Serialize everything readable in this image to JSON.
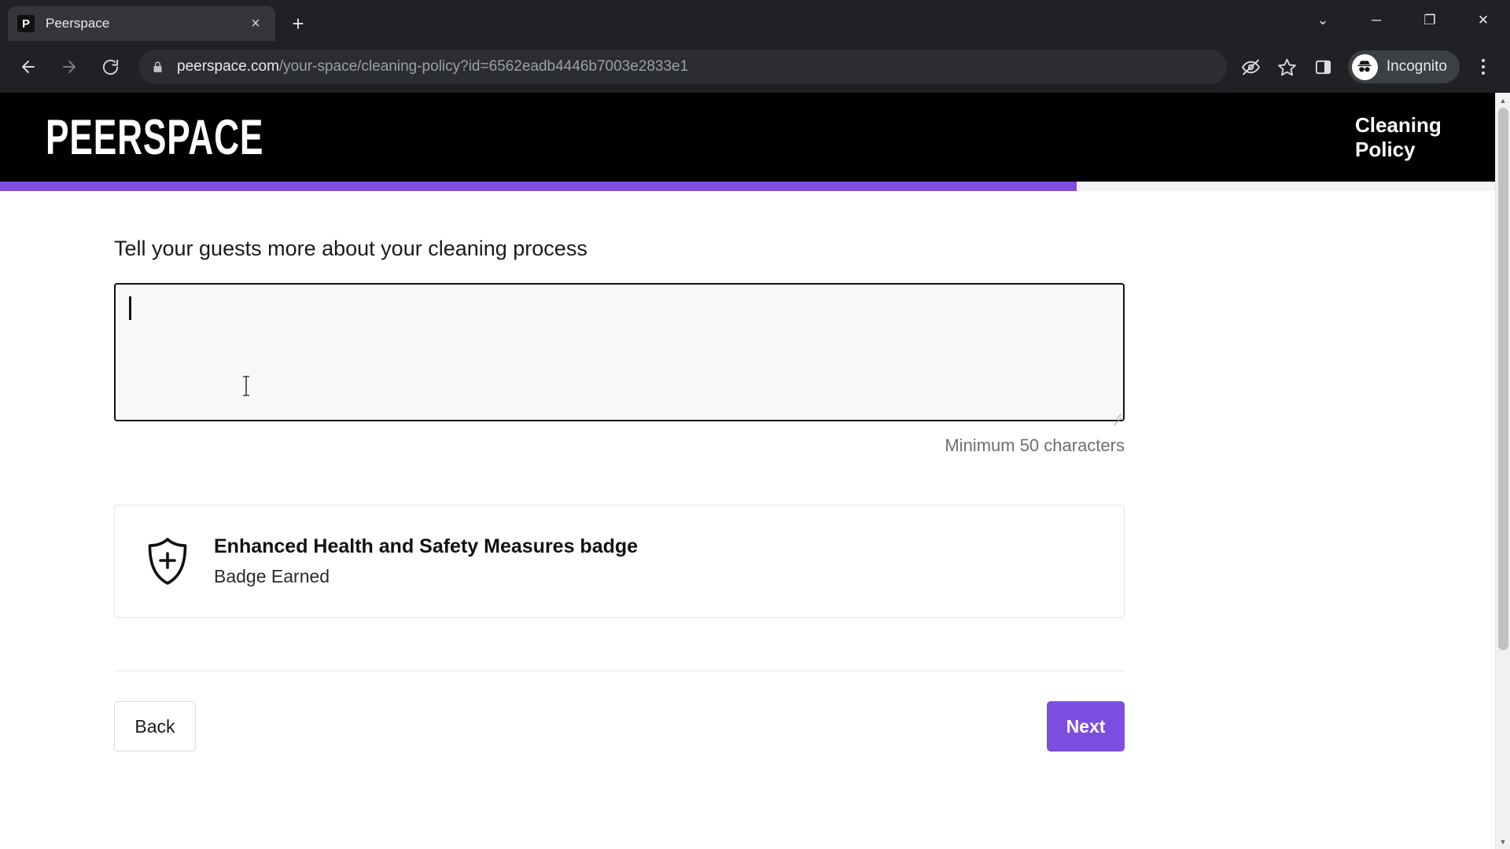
{
  "browser": {
    "tab": {
      "title": "Peerspace",
      "favicon_letter": "P",
      "favicon_name": "peerspace-favicon",
      "close_label": "×"
    },
    "new_tab_label": "+",
    "window_controls": {
      "minimize_all": "⌄",
      "minimize": "─",
      "maximize": "❐",
      "close": "✕"
    },
    "nav": {
      "back": "←",
      "forward": "→",
      "reload": "⟳"
    },
    "omnibox": {
      "lock_icon": "lock-icon",
      "url_host": "peerspace.com",
      "url_path": "/your-space/cleaning-policy?id=6562eadb4446b7003e2833e1",
      "full_url": "peerspace.com/your-space/cleaning-policy?id=6562eadb4446b7003e2833e1"
    },
    "toolbar_icons": [
      "third-party-cookie-blocked-icon",
      "bookmark-star-icon",
      "side-panel-icon"
    ],
    "profile": {
      "label": "Incognito",
      "avatar_icon": "incognito-avatar-icon"
    },
    "menu_icon": "kebab-menu-icon"
  },
  "page": {
    "header": {
      "logo_text": "PEERSPACE",
      "step_title_line1": "Cleaning",
      "step_title_line2": "Policy"
    },
    "progress": {
      "percent": 72,
      "fill_color": "#7c4ee0",
      "track_color": "#f4f4f6"
    },
    "main": {
      "section_title": "Tell your guests more about your cleaning process",
      "textarea": {
        "value": "",
        "placeholder": ""
      },
      "helper_text": "Minimum 50 characters",
      "badge": {
        "icon": "shield-plus-icon",
        "title": "Enhanced Health and Safety Measures badge",
        "status": "Badge Earned"
      },
      "actions": {
        "back_label": "Back",
        "next_label": "Next"
      }
    }
  },
  "colors": {
    "brand_purple": "#7c4ee0",
    "header_black": "#000000",
    "chrome_dark": "#202124"
  }
}
